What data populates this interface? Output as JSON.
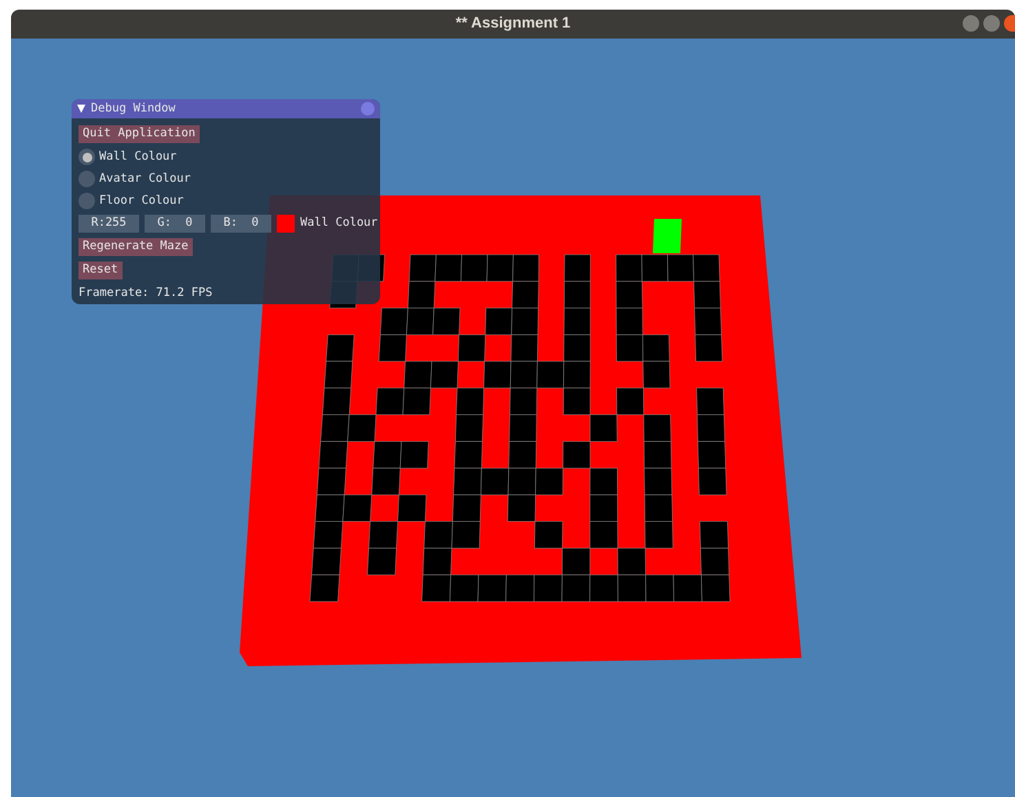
{
  "window": {
    "title": "** Assignment 1"
  },
  "debug_window": {
    "title": "Debug Window",
    "expanded": true,
    "quit_button": "Quit Application",
    "radios": [
      {
        "label": "Wall Colour",
        "selected": true
      },
      {
        "label": "Avatar Colour",
        "selected": false
      },
      {
        "label": "Floor Colour",
        "selected": false
      }
    ],
    "color_fields": [
      "R:255",
      "G:  0",
      "B:  0"
    ],
    "color_swatch": {
      "color": "#ff0000",
      "label": "Wall Colour"
    },
    "regenerate_button": "Regenerate Maze",
    "reset_button": "Reset",
    "framerate": "Framerate: 71.2 FPS"
  }
}
